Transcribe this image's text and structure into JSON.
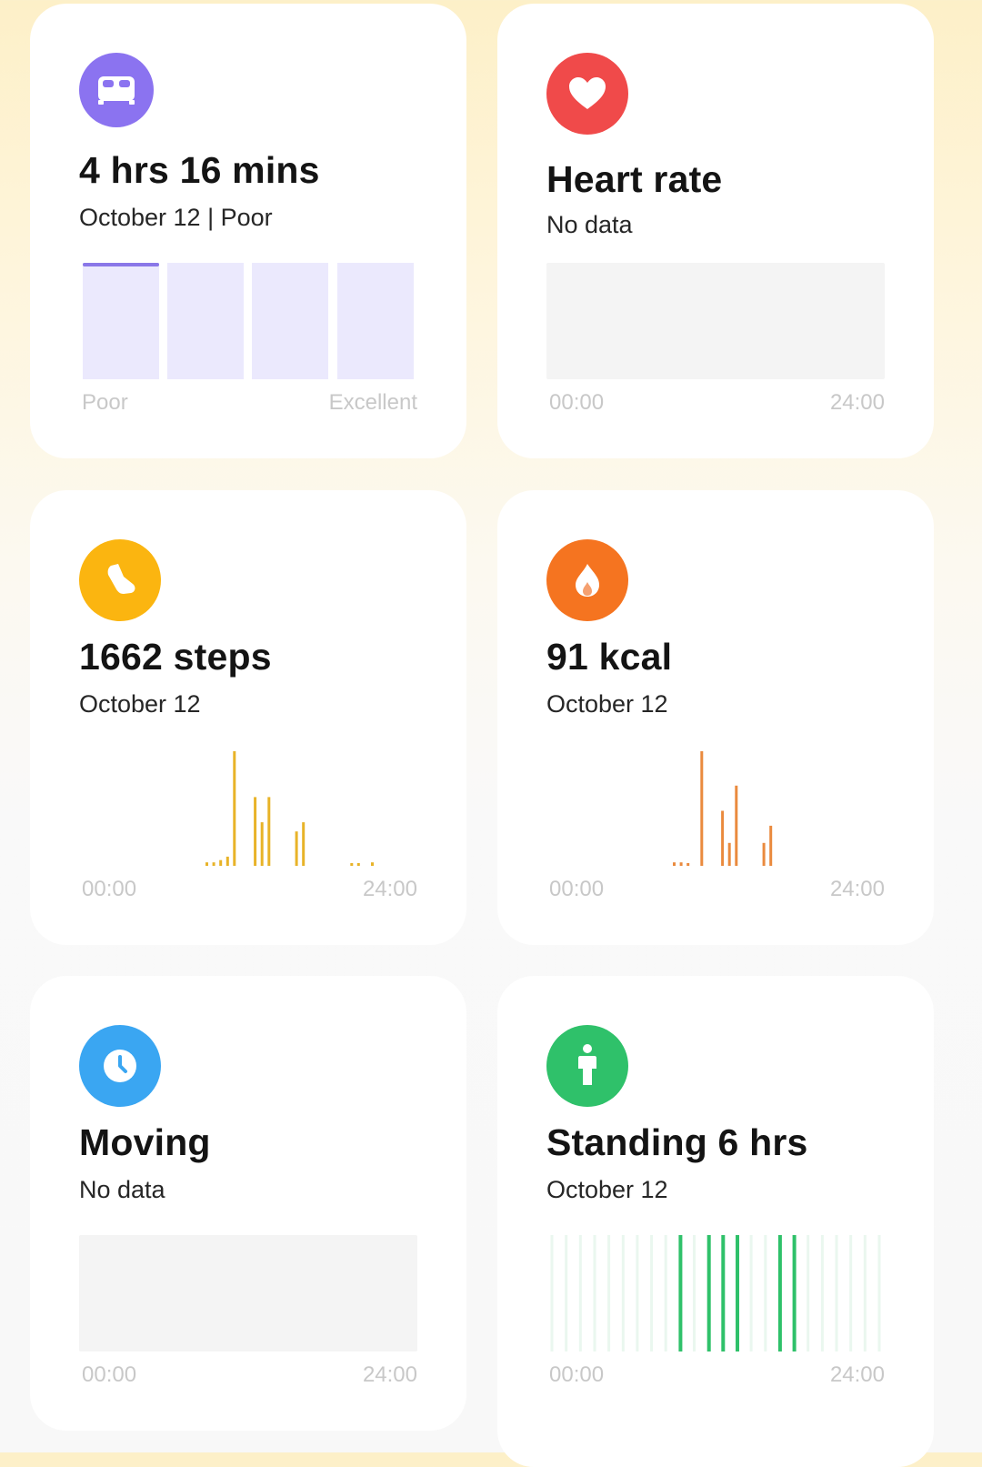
{
  "cards": {
    "sleep": {
      "icon": "bed-icon",
      "color": "#8b73f0",
      "title": "4 hrs 16 mins",
      "subtitle": "October 12 | Poor",
      "scale": {
        "min_label": "Poor",
        "max_label": "Excellent",
        "segments": 4,
        "current_segment": 1
      }
    },
    "heart_rate": {
      "icon": "heart-icon",
      "color": "#f04a4a",
      "title": "Heart rate",
      "subtitle": "No data",
      "axis": {
        "start": "00:00",
        "end": "24:00"
      }
    },
    "steps": {
      "icon": "shoe-icon",
      "color": "#fbb510",
      "title": "1662 steps",
      "subtitle": "October 12",
      "axis": {
        "start": "00:00",
        "end": "24:00"
      }
    },
    "calories": {
      "icon": "flame-icon",
      "color": "#f57420",
      "title": "91 kcal",
      "subtitle": "October 12",
      "axis": {
        "start": "00:00",
        "end": "24:00"
      }
    },
    "moving": {
      "icon": "clock-icon",
      "color": "#3aa6f2",
      "title": "Moving",
      "subtitle": "No data",
      "axis": {
        "start": "00:00",
        "end": "24:00"
      }
    },
    "standing": {
      "icon": "person-standing-icon",
      "color": "#2fc16a",
      "title": "Standing 6 hrs",
      "subtitle": "October 12",
      "axis": {
        "start": "00:00",
        "end": "24:00"
      }
    }
  },
  "chart_data": [
    {
      "type": "bar",
      "id": "steps",
      "x": [
        9.0,
        9.5,
        10.0,
        10.5,
        11.0,
        12.5,
        13.0,
        13.5,
        15.5,
        16.0,
        19.5,
        20.0,
        21.0
      ],
      "values": [
        0.03,
        0.03,
        0.05,
        0.08,
        1.0,
        0.6,
        0.38,
        0.6,
        0.3,
        0.38,
        0.0,
        0.0,
        0.03
      ],
      "xlim": [
        0,
        24
      ],
      "bar_color": "#e8b328"
    },
    {
      "type": "bar",
      "id": "calories",
      "x": [
        9.0,
        9.5,
        10.0,
        11.0,
        12.5,
        13.0,
        13.5,
        15.5,
        16.0
      ],
      "values": [
        0.03,
        0.03,
        0.0,
        1.0,
        0.48,
        0.2,
        0.7,
        0.2,
        0.35
      ],
      "xlim": [
        0,
        24
      ],
      "bar_color": "#ea8a3e"
    },
    {
      "type": "bar",
      "id": "standing",
      "x": [
        0,
        1,
        2,
        3,
        4,
        5,
        6,
        7,
        8,
        9,
        10,
        11,
        12,
        13,
        14,
        15,
        16,
        17,
        18,
        19,
        20,
        21,
        22,
        23
      ],
      "values": [
        0,
        0,
        0,
        0,
        0,
        0,
        0,
        0,
        0,
        1,
        0,
        1,
        1,
        1,
        0,
        0,
        1,
        1,
        0,
        0,
        0,
        0,
        0,
        0
      ],
      "xlim": [
        0,
        24
      ],
      "bar_color": "#2fc16a",
      "inactive_color": "#eaf7ef"
    }
  ]
}
